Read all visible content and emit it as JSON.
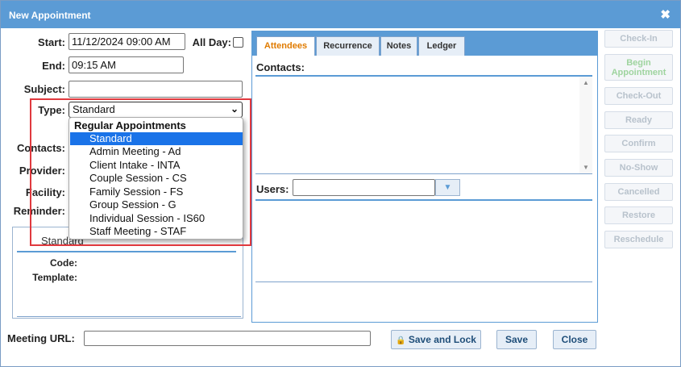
{
  "dialog": {
    "title": "New Appointment",
    "close_glyph": "✖"
  },
  "form": {
    "start_label": "Start:",
    "start_value": "11/12/2024 09:00 AM",
    "allday_label": "All Day:",
    "end_label": "End:",
    "end_value": "09:15 AM",
    "subject_label": "Subject:",
    "subject_value": "",
    "type_label": "Type:",
    "type_value": "Standard",
    "contacts_label": "Contacts:",
    "provider_label": "Provider:",
    "facility_label": "Facility:",
    "reminder_label": "Reminder:"
  },
  "type_dropdown": {
    "group": "Regular Appointments",
    "options": [
      "Standard",
      "Admin Meeting - Ad",
      "Client Intake - INTA",
      "Couple Session - CS",
      "Family Session - FS",
      "Group Session - G",
      "Individual Session - IS60",
      "Staff Meeting - STAF"
    ],
    "selected_index": 0
  },
  "type_info": {
    "name": "Standard",
    "code_label": "Code:",
    "template_label": "Template:"
  },
  "tabs": [
    {
      "label": "Attendees",
      "active": true
    },
    {
      "label": "Recurrence",
      "active": false
    },
    {
      "label": "Notes",
      "active": false
    },
    {
      "label": "Ledger",
      "active": false
    }
  ],
  "attendees": {
    "contacts_label": "Contacts:",
    "users_label": "Users:"
  },
  "side_buttons": [
    {
      "label": "Check-In"
    },
    {
      "label": "Begin Appointment"
    },
    {
      "label": "Check-Out"
    },
    {
      "label": "Ready"
    },
    {
      "label": "Confirm"
    },
    {
      "label": "No-Show"
    },
    {
      "label": "Cancelled"
    },
    {
      "label": "Restore"
    },
    {
      "label": "Reschedule"
    }
  ],
  "footer": {
    "meeting_url_label": "Meeting URL:",
    "meeting_url_value": "",
    "save_lock_label": "Save and Lock",
    "save_label": "Save",
    "close_label": "Close"
  },
  "colors": {
    "titlebar": "#5b9bd5",
    "highlight": "#e0393e",
    "active_tab_text": "#e07b00",
    "selected_option": "#1a73e8"
  }
}
